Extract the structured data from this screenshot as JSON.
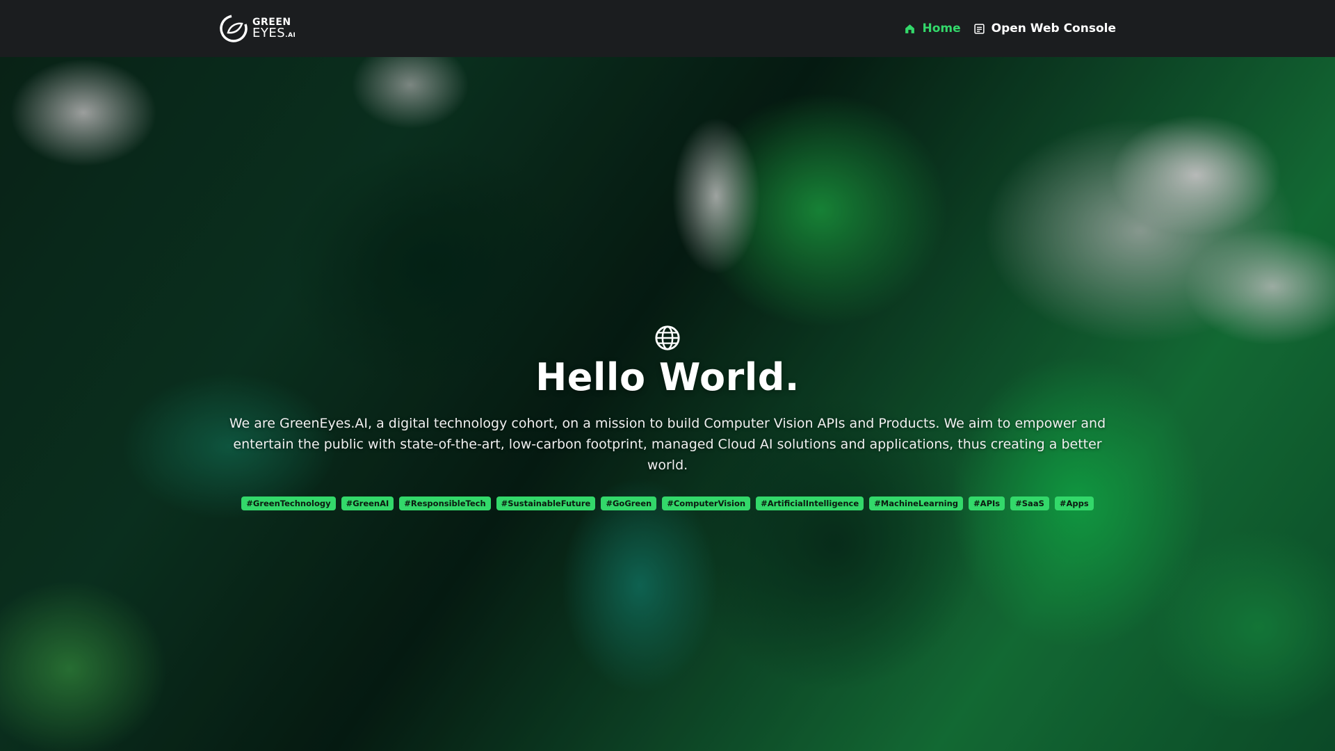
{
  "brand": {
    "line1": "GREEN",
    "line2": "EYES",
    "suffix": ".AI",
    "accent_color": "#33d86a"
  },
  "nav": {
    "items": [
      {
        "label": "Home",
        "icon": "home-icon",
        "active": true
      },
      {
        "label": "Open Web Console",
        "icon": "document-icon",
        "active": false
      }
    ]
  },
  "hero": {
    "icon": "globe-icon",
    "title": "Hello World.",
    "description": "We are GreenEyes.AI, a digital technology cohort, on a mission to build Computer Vision APIs and Products. We aim to empower and entertain the public with state-of-the-art, low-carbon footprint, managed Cloud AI solutions and applications, thus creating a better world.",
    "tags": [
      "#GreenTechnology",
      "#GreenAI",
      "#ResponsibleTech",
      "#SustainableFuture",
      "#GoGreen",
      "#ComputerVision",
      "#ArtificialIntelligence",
      "#MachineLearning",
      "#APIs",
      "#SaaS",
      "#Apps"
    ]
  }
}
